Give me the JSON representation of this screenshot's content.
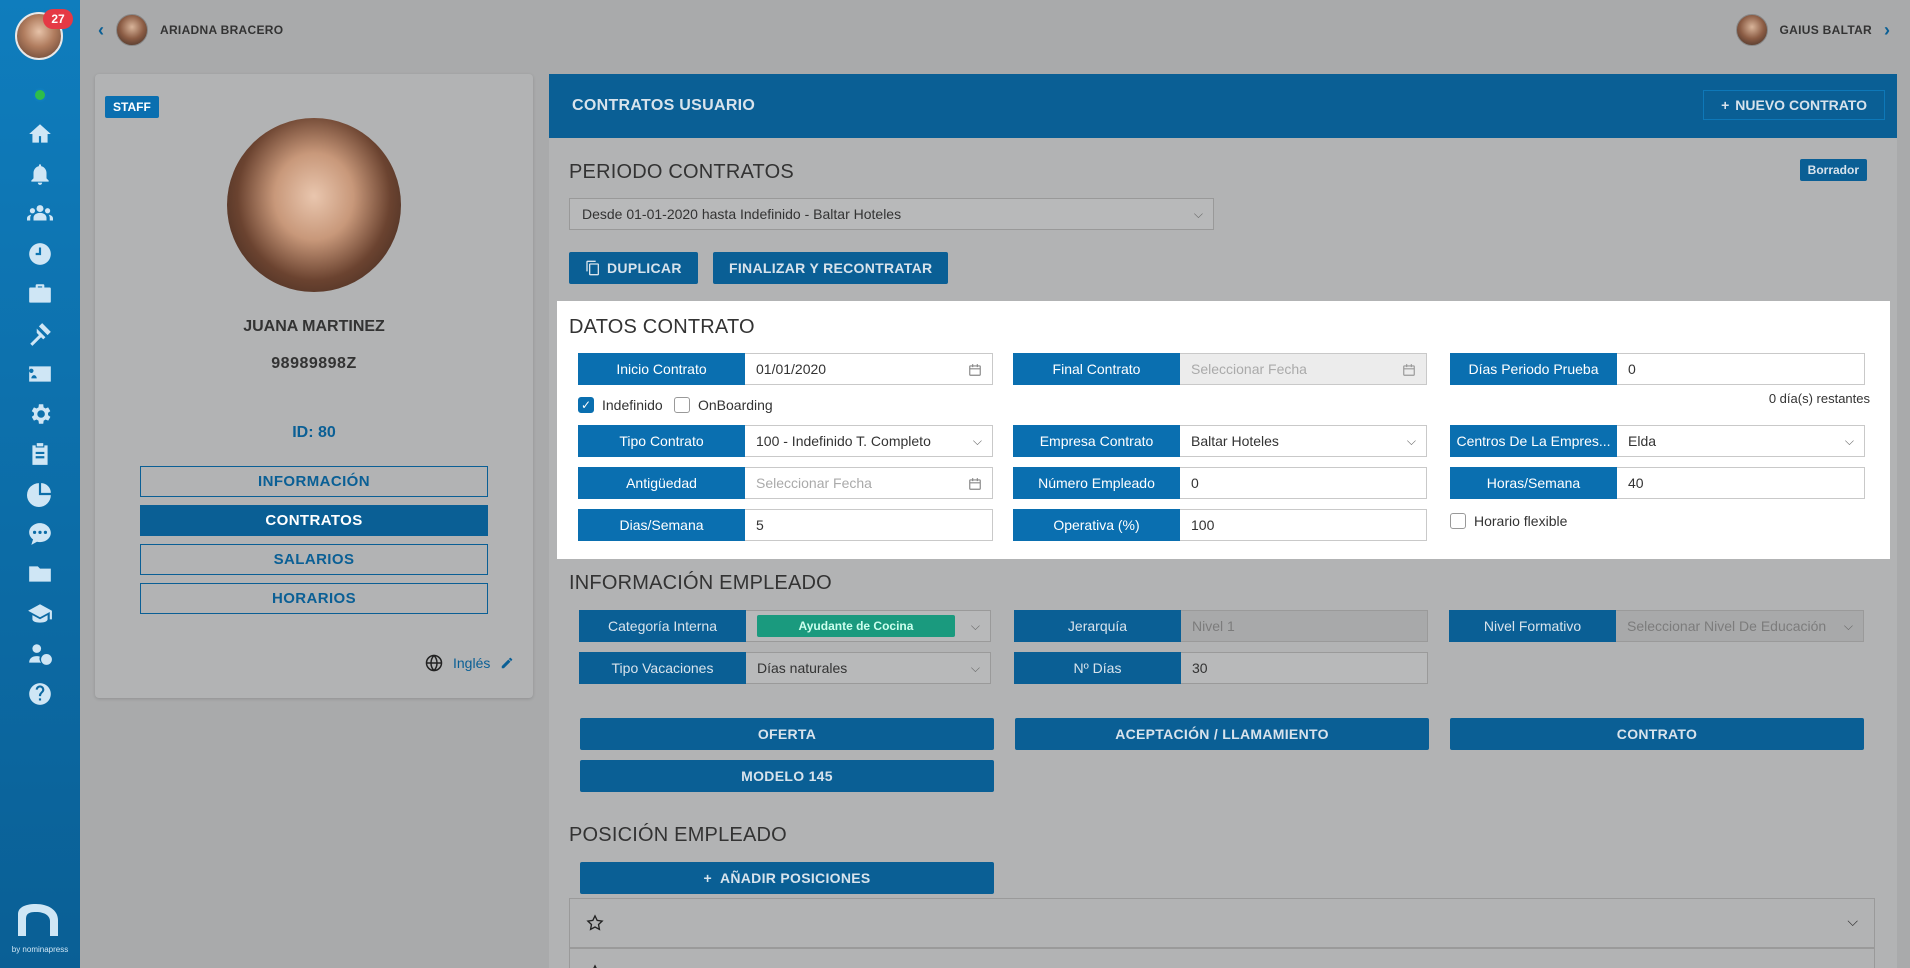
{
  "sidebar": {
    "badge_count": "27",
    "brand_text": "by nominapress",
    "icons": [
      "home-icon",
      "bell-icon",
      "users-icon",
      "clock-icon",
      "briefcase-icon",
      "gavel-icon",
      "id-card-icon",
      "gear-icon",
      "clipboard-icon",
      "pie-chart-icon",
      "chat-icon",
      "folder-icon",
      "graduation-cap-icon",
      "user-money-icon",
      "help-icon"
    ]
  },
  "topbar": {
    "left_user": "ARIADNA BRACERO",
    "right_user": "GAIUS BALTAR"
  },
  "profile": {
    "badge": "STAFF",
    "name": "JUANA MARTINEZ",
    "dni": "98989898Z",
    "id": "ID: 80",
    "buttons": [
      "INFORMACIÓN",
      "CONTRATOS",
      "SALARIOS",
      "HORARIOS"
    ],
    "language": "Inglés"
  },
  "main": {
    "title": "CONTRATOS USUARIO",
    "new_contract": "NUEVO CONTRATO",
    "period_title": "PERIODO CONTRATOS",
    "status": "Borrador",
    "period_value": "Desde 01-01-2020 hasta Indefinido - Baltar Hoteles",
    "duplicate": "DUPLICAR",
    "finalize": "FINALIZAR Y RECONTRATAR"
  },
  "datos": {
    "title": "DATOS CONTRATO",
    "inicio_label": "Inicio Contrato",
    "inicio_value": "01/01/2020",
    "final_label": "Final Contrato",
    "final_placeholder": "Seleccionar Fecha",
    "prueba_label": "Días Periodo Prueba",
    "prueba_value": "0",
    "restantes": "0 día(s) restantes",
    "indefinido": "Indefinido",
    "onboarding": "OnBoarding",
    "tipo_label": "Tipo Contrato",
    "tipo_value": "100 - Indefinido T. Completo",
    "empresa_label": "Empresa Contrato",
    "empresa_value": "Baltar Hoteles",
    "centros_label": "Centros De La Empres...",
    "centros_value": "Elda",
    "antiguedad_label": "Antigüedad",
    "antiguedad_placeholder": "Seleccionar Fecha",
    "numero_label": "Número Empleado",
    "numero_value": "0",
    "horas_label": "Horas/Semana",
    "horas_value": "40",
    "dias_label": "Dias/Semana",
    "dias_value": "5",
    "operativa_label": "Operativa (%)",
    "operativa_value": "100",
    "horario_flexible": "Horario flexible"
  },
  "empleado": {
    "title": "INFORMACIÓN EMPLEADO",
    "categoria_label": "Categoría Interna",
    "categoria_value": "Ayudante de Cocina",
    "jerarquia_label": "Jerarquía",
    "jerarquia_value": "Nivel 1",
    "nivel_label": "Nivel Formativo",
    "nivel_placeholder": "Seleccionar Nivel De Educación",
    "vacaciones_label": "Tipo Vacaciones",
    "vacaciones_value": "Días naturales",
    "ndias_label": "Nº Días",
    "ndias_value": "30",
    "docs": [
      "OFERTA",
      "ACEPTACIÓN / LLAMAMIENTO",
      "CONTRATO",
      "MODELO 145"
    ]
  },
  "posicion": {
    "title": "POSICIÓN EMPLEADO",
    "add": "AÑADIR POSICIONES"
  }
}
